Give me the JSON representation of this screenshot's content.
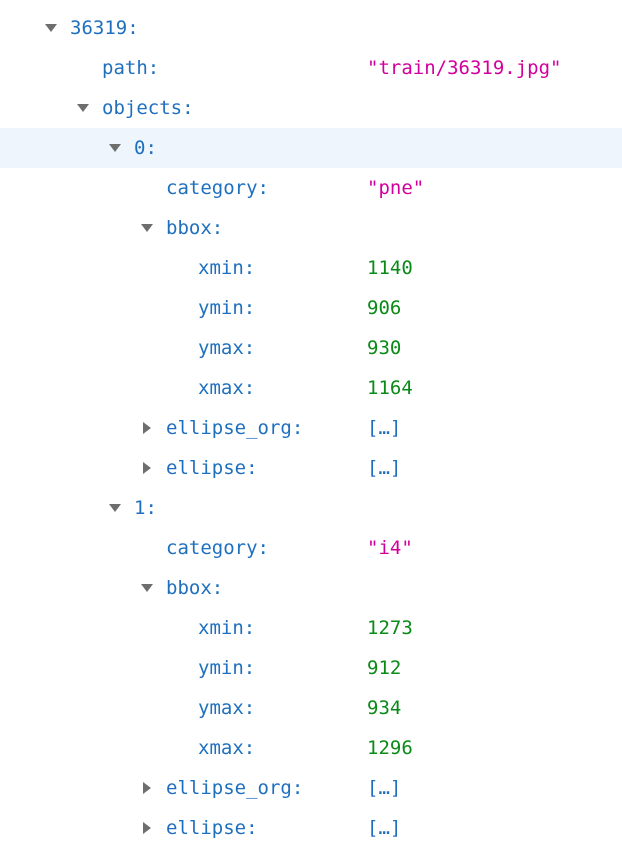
{
  "colors": {
    "key": "#1f6fbf",
    "string": "#d1009c",
    "number": "#0a8a17",
    "selected_row_bg": "#eef5fc",
    "toggle": "#6e6e6e"
  },
  "icons": {
    "expanded": "triangle-down-icon",
    "collapsed": "triangle-right-icon"
  },
  "tree": {
    "root_key": "36319:",
    "path_key": "path:",
    "path_value": "\"train/36319.jpg\"",
    "objects_key": "objects:",
    "objects": [
      {
        "index_key": "0:",
        "category_key": "category:",
        "category_value": "\"pne\"",
        "bbox_key": "bbox:",
        "bbox": [
          {
            "key": "xmin:",
            "value": "1140"
          },
          {
            "key": "ymin:",
            "value": "906"
          },
          {
            "key": "ymax:",
            "value": "930"
          },
          {
            "key": "xmax:",
            "value": "1164"
          }
        ],
        "ellipse_org_key": "ellipse_org:",
        "ellipse_org_value": "[…]",
        "ellipse_key": "ellipse:",
        "ellipse_value": "[…]"
      },
      {
        "index_key": "1:",
        "category_key": "category:",
        "category_value": "\"i4\"",
        "bbox_key": "bbox:",
        "bbox": [
          {
            "key": "xmin:",
            "value": "1273"
          },
          {
            "key": "ymin:",
            "value": "912"
          },
          {
            "key": "ymax:",
            "value": "934"
          },
          {
            "key": "xmax:",
            "value": "1296"
          }
        ],
        "ellipse_org_key": "ellipse_org:",
        "ellipse_org_value": "[…]",
        "ellipse_key": "ellipse:",
        "ellipse_value": "[…]"
      }
    ]
  }
}
